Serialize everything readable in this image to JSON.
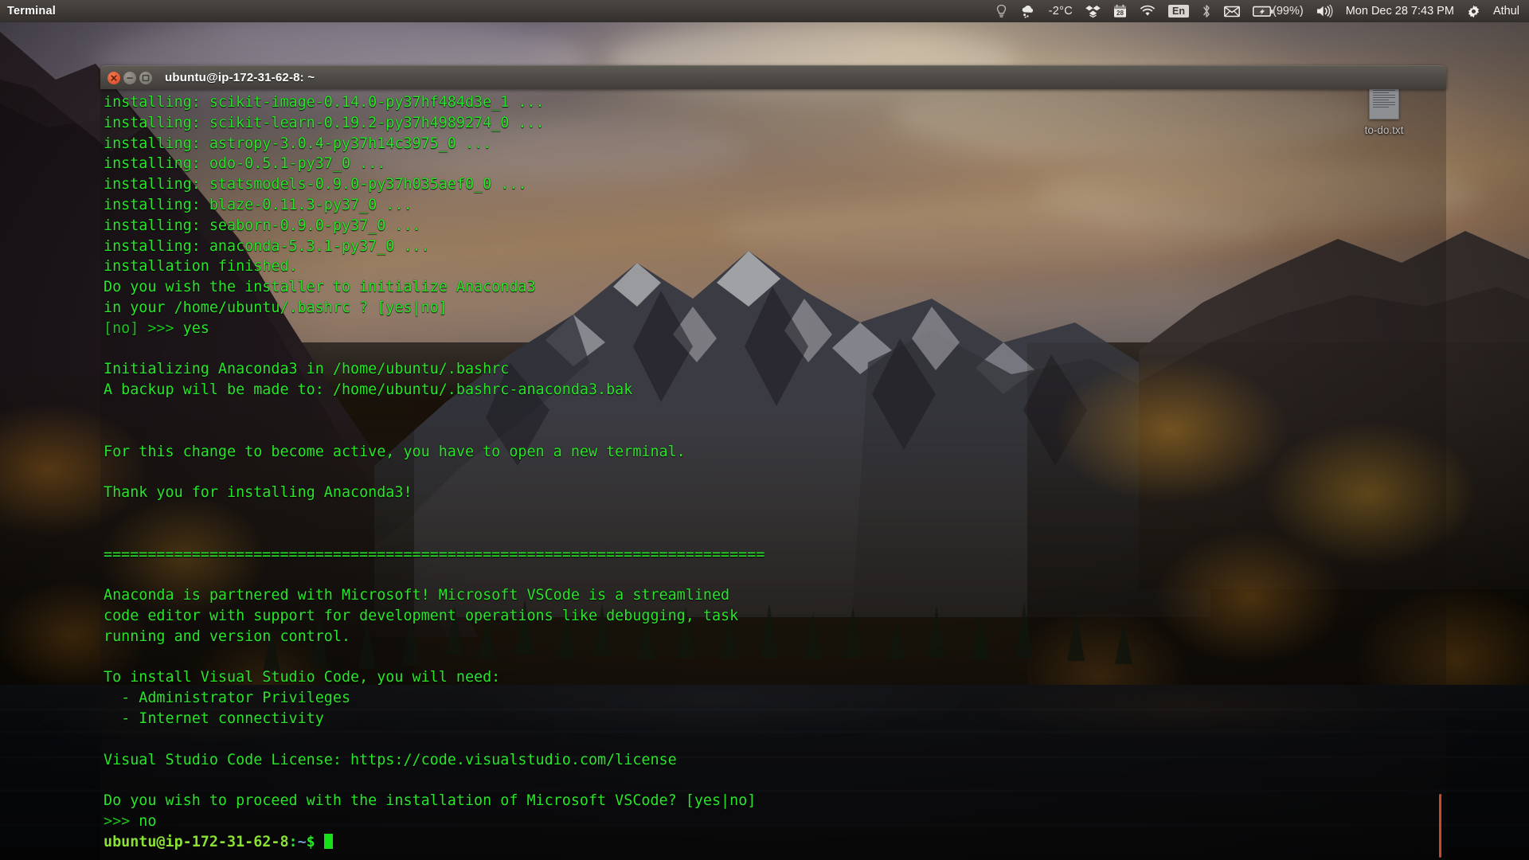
{
  "panel": {
    "app_title": "Terminal",
    "indicators": [
      {
        "name": "bulb-icon",
        "glyph": "bulb"
      },
      {
        "name": "weather-icon",
        "glyph": "cloud-snow"
      },
      {
        "name": "temperature-label",
        "text": "-2°C"
      },
      {
        "name": "dropbox-icon",
        "glyph": "dropbox"
      },
      {
        "name": "calendar-icon",
        "glyph": "calendar",
        "day": "28"
      },
      {
        "name": "wifi-icon",
        "glyph": "wifi"
      },
      {
        "name": "keyboard-layout-indicator",
        "text": "En"
      },
      {
        "name": "bluetooth-icon",
        "glyph": "bluetooth"
      },
      {
        "name": "messaging-icon",
        "glyph": "envelope"
      },
      {
        "name": "battery-icon",
        "glyph": "battery-charging"
      },
      {
        "name": "battery-percent-label",
        "text": "(99%)"
      },
      {
        "name": "volume-icon",
        "glyph": "speaker"
      }
    ],
    "clock": "Mon Dec 28  7:43 PM",
    "username": "Athul",
    "session_icon": "gear-icon"
  },
  "desktop": {
    "icons": [
      {
        "name": "to-do-file-icon",
        "label": "to-do.txt"
      }
    ]
  },
  "terminal": {
    "title": "ubuntu@ip-172-31-62-8: ~",
    "window_buttons": [
      "close",
      "minimize",
      "maximize"
    ],
    "prompt": {
      "user_host": "ubuntu@ip-172-31-62-8",
      "separator": ":",
      "path": "~",
      "sigil": "$"
    },
    "lines": [
      "installing: scikit-image-0.14.0-py37hf484d3e_1 ...",
      "installing: scikit-learn-0.19.2-py37h4989274_0 ...",
      "installing: astropy-3.0.4-py37h14c3975_0 ...",
      "installing: odo-0.5.1-py37_0 ...",
      "installing: statsmodels-0.9.0-py37h035aef0_0 ...",
      "installing: blaze-0.11.3-py37_0 ...",
      "installing: seaborn-0.9.0-py37_0 ...",
      "installing: anaconda-5.3.1-py37_0 ...",
      "installation finished.",
      "Do you wish the installer to initialize Anaconda3",
      "in your /home/ubuntu/.bashrc ? [yes|no]",
      "[no] >>> yes",
      "",
      "Initializing Anaconda3 in /home/ubuntu/.bashrc",
      "A backup will be made to: /home/ubuntu/.bashrc-anaconda3.bak",
      "",
      "",
      "For this change to become active, you have to open a new terminal.",
      "",
      "Thank you for installing Anaconda3!",
      "",
      "",
      "===========================================================================",
      "",
      "Anaconda is partnered with Microsoft! Microsoft VSCode is a streamlined",
      "code editor with support for development operations like debugging, task",
      "running and version control.",
      "",
      "To install Visual Studio Code, you will need:",
      "  - Administrator Privileges",
      "  - Internet connectivity",
      "",
      "Visual Studio Code License: https://code.visualstudio.com/license",
      "",
      "Do you wish to proceed with the installation of Microsoft VSCode? [yes|no]",
      ">>> no"
    ]
  },
  "colors": {
    "terminal_green": "#2ae52a",
    "prompt_user": "#8ae234",
    "prompt_path": "#729fcf",
    "panel_bg": "#3f3a36",
    "close_button": "#d8472a",
    "scrollbar": "#c94a2b"
  }
}
